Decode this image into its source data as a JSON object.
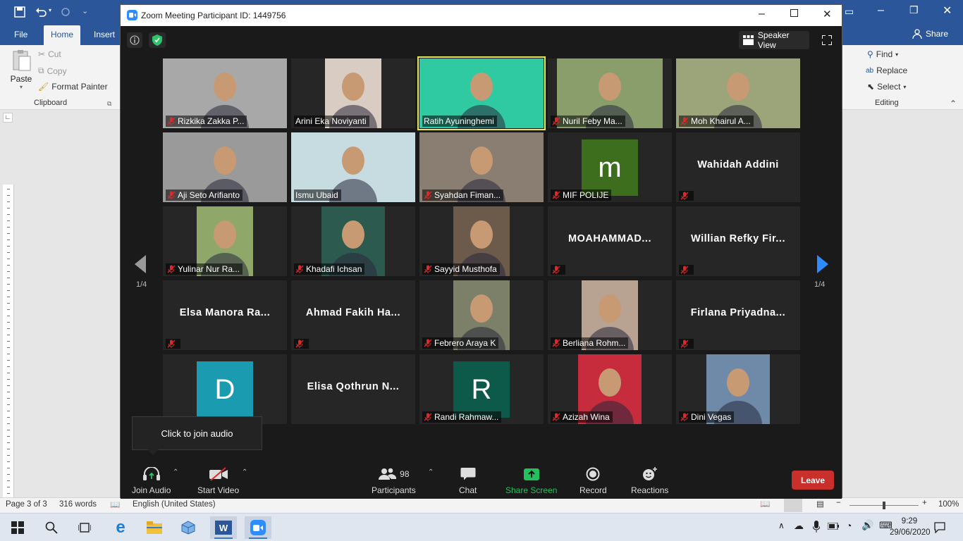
{
  "word": {
    "tabs": [
      "File",
      "Home",
      "Insert"
    ],
    "share_label": "Share",
    "clipboard": {
      "paste": "Paste",
      "cut": "Cut",
      "copy": "Copy",
      "format_painter": "Format Painter",
      "group": "Clipboard"
    },
    "editing": {
      "find": "Find",
      "replace": "Replace",
      "select": "Select",
      "group": "Editing"
    },
    "status": {
      "page": "Page 3 of 3",
      "words": "316 words",
      "language": "English (United States)",
      "zoom": "100%"
    }
  },
  "zoom": {
    "title": "Zoom Meeting Participant ID: 1449756",
    "speaker_view": "Speaker View",
    "page_left": "1/4",
    "page_right": "1/4",
    "tooltip": "Click to join audio",
    "participants": [
      {
        "name": "Rizkika Zakka P...",
        "kind": "video",
        "muted": true,
        "bg": "#a8a8a8"
      },
      {
        "name": "Arini Eka Noviyanti",
        "kind": "video",
        "muted": false,
        "bg": "#d9ccc2"
      },
      {
        "name": "Ratih Ayuninghemi",
        "kind": "video",
        "muted": false,
        "bg": "#2fc9a2",
        "active": true
      },
      {
        "name": "Nuril Feby Ma...",
        "kind": "video",
        "muted": true,
        "bg": "#8a9e6c"
      },
      {
        "name": "Moh Khairul A...",
        "kind": "video",
        "muted": true,
        "bg": "#9ca47a"
      },
      {
        "name": "Aji Seto Arifianto",
        "kind": "video",
        "muted": true,
        "bg": "#9a9a9a"
      },
      {
        "name": "Ismu Ubaid",
        "kind": "video",
        "muted": false,
        "bg": "#c6dce0"
      },
      {
        "name": "Syahdan Fiman...",
        "kind": "video",
        "muted": true,
        "bg": "#8a7e72"
      },
      {
        "name": "MIF POLIJE",
        "kind": "avatar",
        "muted": true,
        "letter": "m",
        "color": "#3c6e1e"
      },
      {
        "name": "",
        "kind": "text",
        "muted": true,
        "display": "Wahidah Addini"
      },
      {
        "name": "Yulinar Nur Ra...",
        "kind": "video",
        "muted": true,
        "bg": "#8fa86a"
      },
      {
        "name": "Khadafi Ichsan",
        "kind": "video",
        "muted": true,
        "bg": "#2d5a4e"
      },
      {
        "name": "Sayyid Musthofa",
        "kind": "video",
        "muted": true,
        "bg": "#6c5a4a"
      },
      {
        "name": "",
        "kind": "text",
        "muted": true,
        "display": "MOAHAMMAD..."
      },
      {
        "name": "",
        "kind": "text",
        "muted": true,
        "display": "Willian  Refky  Fir..."
      },
      {
        "name": "",
        "kind": "text",
        "muted": true,
        "display": "Elsa  Manora  Ra..."
      },
      {
        "name": "",
        "kind": "text",
        "muted": true,
        "display": "Ahmad  Fakih  Ha..."
      },
      {
        "name": "Febrero Araya K",
        "kind": "video",
        "muted": true,
        "bg": "#7c8068"
      },
      {
        "name": "Berliana Rohm...",
        "kind": "video",
        "muted": true,
        "bg": "#b8a292"
      },
      {
        "name": "",
        "kind": "text",
        "muted": true,
        "display": "Firlana  Priyadna..."
      },
      {
        "name": "",
        "kind": "avatar",
        "muted": false,
        "letter": "D",
        "color": "#1a9bb0"
      },
      {
        "name": "",
        "kind": "text",
        "muted": false,
        "display": "Elisa  Qothrun  N..."
      },
      {
        "name": "Randi Rahmaw...",
        "kind": "avatar",
        "muted": true,
        "letter": "R",
        "color": "#0e5a4a"
      },
      {
        "name": "Azizah Wina",
        "kind": "video",
        "muted": true,
        "bg": "#c72c3c"
      },
      {
        "name": "Dini Vegas",
        "kind": "video",
        "muted": true,
        "bg": "#6e8aa8"
      }
    ],
    "toolbar": {
      "join_audio": "Join Audio",
      "start_video": "Start Video",
      "participants": "Participants",
      "participants_count": "98",
      "chat": "Chat",
      "share_screen": "Share Screen",
      "record": "Record",
      "reactions": "Reactions",
      "leave": "Leave"
    }
  },
  "taskbar": {
    "time": "9:29",
    "date": "29/06/2020"
  },
  "colors": {
    "word_blue": "#2b579a",
    "zoom_bg": "#1a1a1a",
    "share_green": "#22c15e",
    "leave_red": "#c9302c",
    "active_speaker": "#e6e65a"
  }
}
